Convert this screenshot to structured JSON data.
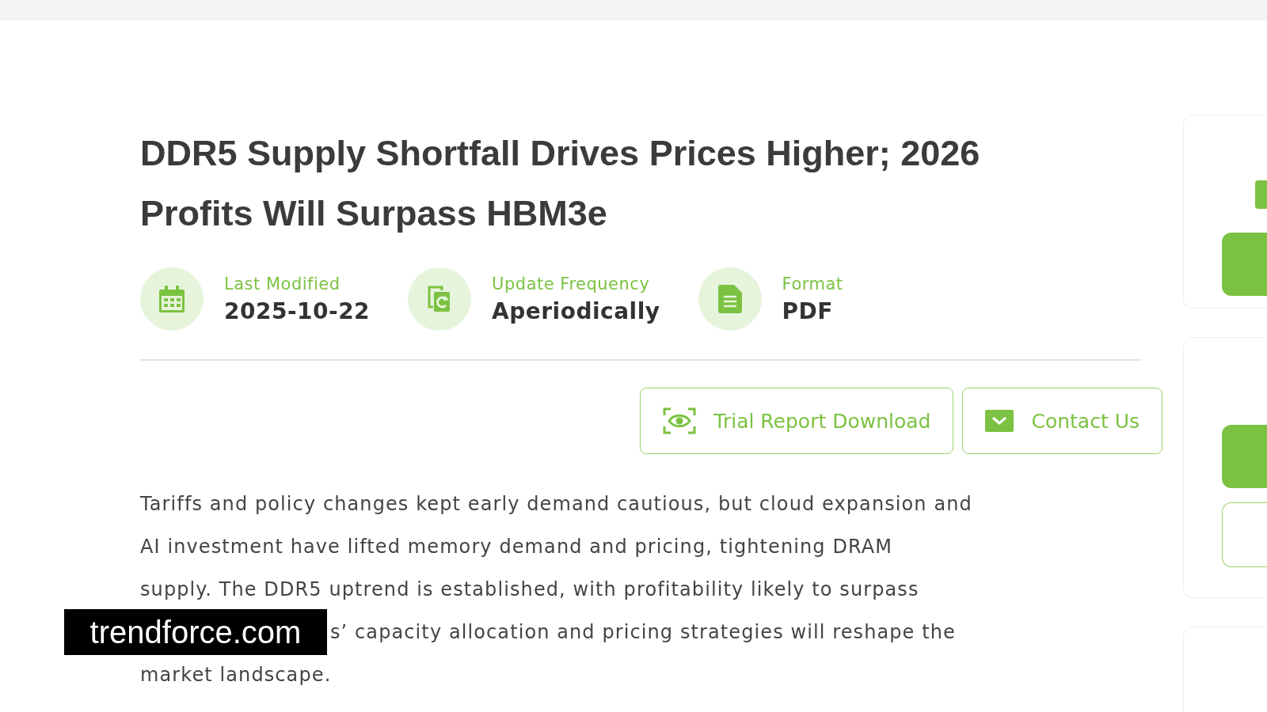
{
  "title": "DDR5 Supply Shortfall Drives Prices Higher; 2026 Profits Will Surpass HBM3e",
  "meta": [
    {
      "kind": "calendar",
      "label": "Last Modified",
      "value": "2025-10-22"
    },
    {
      "kind": "refresh",
      "label": "Update Frequency",
      "value": "Aperiodically"
    },
    {
      "kind": "document",
      "label": "Format",
      "value": "PDF"
    }
  ],
  "buttons": [
    {
      "kind": "scan",
      "label": "Trial Report Download"
    },
    {
      "kind": "mail",
      "label": "Contact Us"
    }
  ],
  "summary_lines": [
    "Tariffs and policy changes kept early demand cautious, but cloud expansion and",
    "AI investment have lifted memory demand and pricing, tightening DRAM",
    "supply. The DDR5 uptrend is established, with profitability likely to surpass",
    "s’ capacity allocation and pricing strategies will reshape the",
    "market landscape."
  ],
  "source_caption": "trendforce.com"
}
